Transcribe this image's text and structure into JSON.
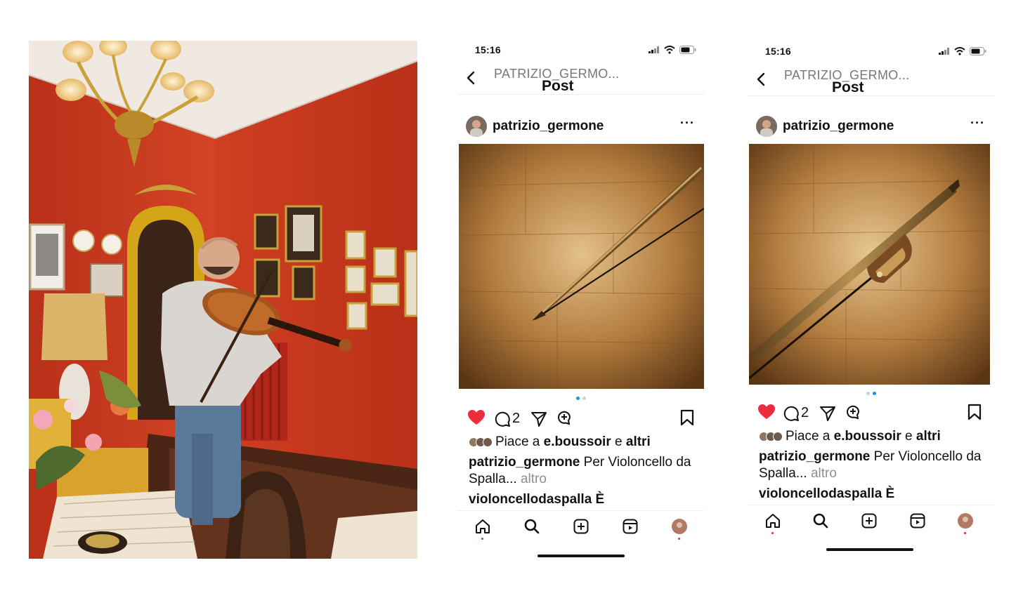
{
  "photo": {
    "description_icon": "violinist-in-red-room-photo"
  },
  "phones": [
    {
      "status_time": "15:16",
      "nav_account": "PATRIZIO_GERMO...",
      "nav_title": "Post",
      "username": "patrizio_germone",
      "more_label": "···",
      "comments_count": "2",
      "likes_prefix": "Piace a",
      "likes_user": "e.boussoir",
      "likes_and": "e",
      "likes_others": "altri",
      "caption_user": "patrizio_germone",
      "caption_text": "Per Violoncello da Spalla...",
      "caption_more": "altro",
      "comment_preview": "violoncellodaspalla È",
      "carousel_active": 0
    },
    {
      "status_time": "15:16",
      "nav_account": "PATRIZIO_GERMO...",
      "nav_title": "Post",
      "username": "patrizio_germone",
      "more_label": "···",
      "comments_count": "2",
      "likes_prefix": "Piace a",
      "likes_user": "e.boussoir",
      "likes_and": "e",
      "likes_others": "altri",
      "caption_user": "patrizio_germone",
      "caption_text": "Per Violoncello da Spalla...",
      "caption_more": "altro",
      "comment_preview": "violoncellodaspalla È",
      "carousel_active": 1
    }
  ],
  "colors": {
    "like_red": "#ed2c3e",
    "carousel_blue": "#1a8fe3",
    "wall_red": "#c73a1f",
    "wood": "#9a6a33"
  }
}
